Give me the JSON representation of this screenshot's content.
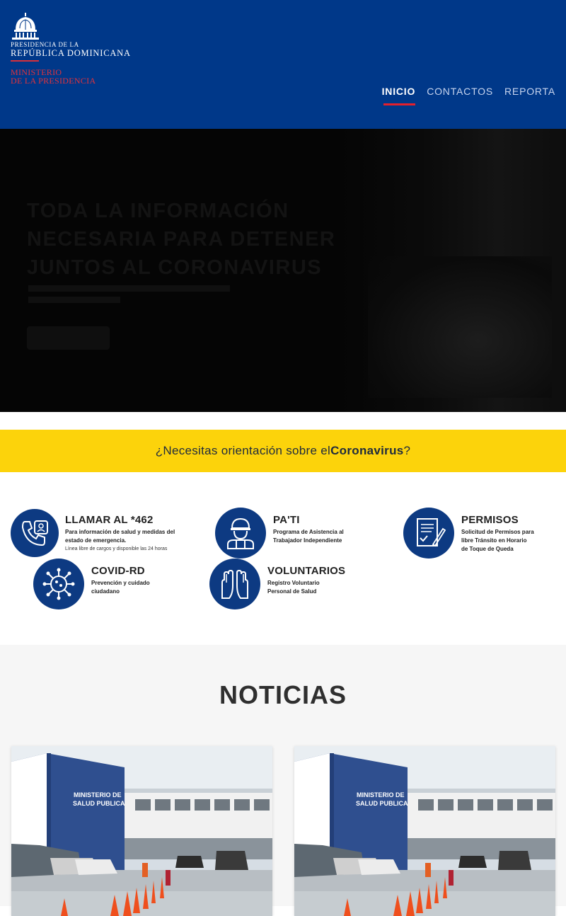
{
  "header": {
    "logo": {
      "line1": "PRESIDENCIA DE LA",
      "line2": "REPÚBLICA DOMINICANA",
      "line3": "MINISTERIO",
      "line4": "DE LA PRESIDENCIA"
    },
    "nav": [
      {
        "label": "INICIO",
        "active": true
      },
      {
        "label": "CONTACTOS",
        "active": false
      },
      {
        "label": "REPORTA",
        "active": false
      }
    ]
  },
  "hero": {
    "title": "TODA LA INFORMACIÓN NECESARIA PARA DETENER JUNTOS AL CORONAVIRUS"
  },
  "banner": {
    "prefix": "¿Necesitas orientación sobre el ",
    "highlight": "Coronavirus",
    "suffix": "?"
  },
  "services": [
    {
      "title": "LLAMAR AL *462",
      "desc1": "Para información de salud y medidas del",
      "desc2": "estado de emergencia.",
      "note": "Línea libre de cargos y disponible las 24 horas",
      "icon": "phone-icon"
    },
    {
      "title": "PA'TI",
      "desc1": "Programa de Asistencia al",
      "desc2": "Trabajador Independiente",
      "icon": "worker-icon"
    },
    {
      "title": "PERMISOS",
      "desc1": "Solicitud de Permisos para",
      "desc2": "libre Tránsito en Horario",
      "desc3": "de Toque de Queda",
      "icon": "document-pen-icon"
    },
    {
      "title": "COVID-RD",
      "desc1": "Prevención y cuidado",
      "desc2": "ciudadano",
      "icon": "virus-icon"
    },
    {
      "title": "VOLUNTARIOS",
      "desc1": "Registro Voluntario",
      "desc2": "Personal de Salud",
      "icon": "raised-hands-icon"
    }
  ],
  "news": {
    "title": "NOTICIAS",
    "cards": [
      {
        "building_sign_line1": "MINISTERIO DE",
        "building_sign_line2": "SALUD PUBLICA"
      },
      {
        "building_sign_line1": "MINISTERIO DE",
        "building_sign_line2": "SALUD PUBLICA"
      }
    ]
  },
  "colors": {
    "header_bg": "#003889",
    "accent_red": "#e4202c",
    "banner_yellow": "#fcd30b",
    "icon_blue": "#0d3a82"
  }
}
